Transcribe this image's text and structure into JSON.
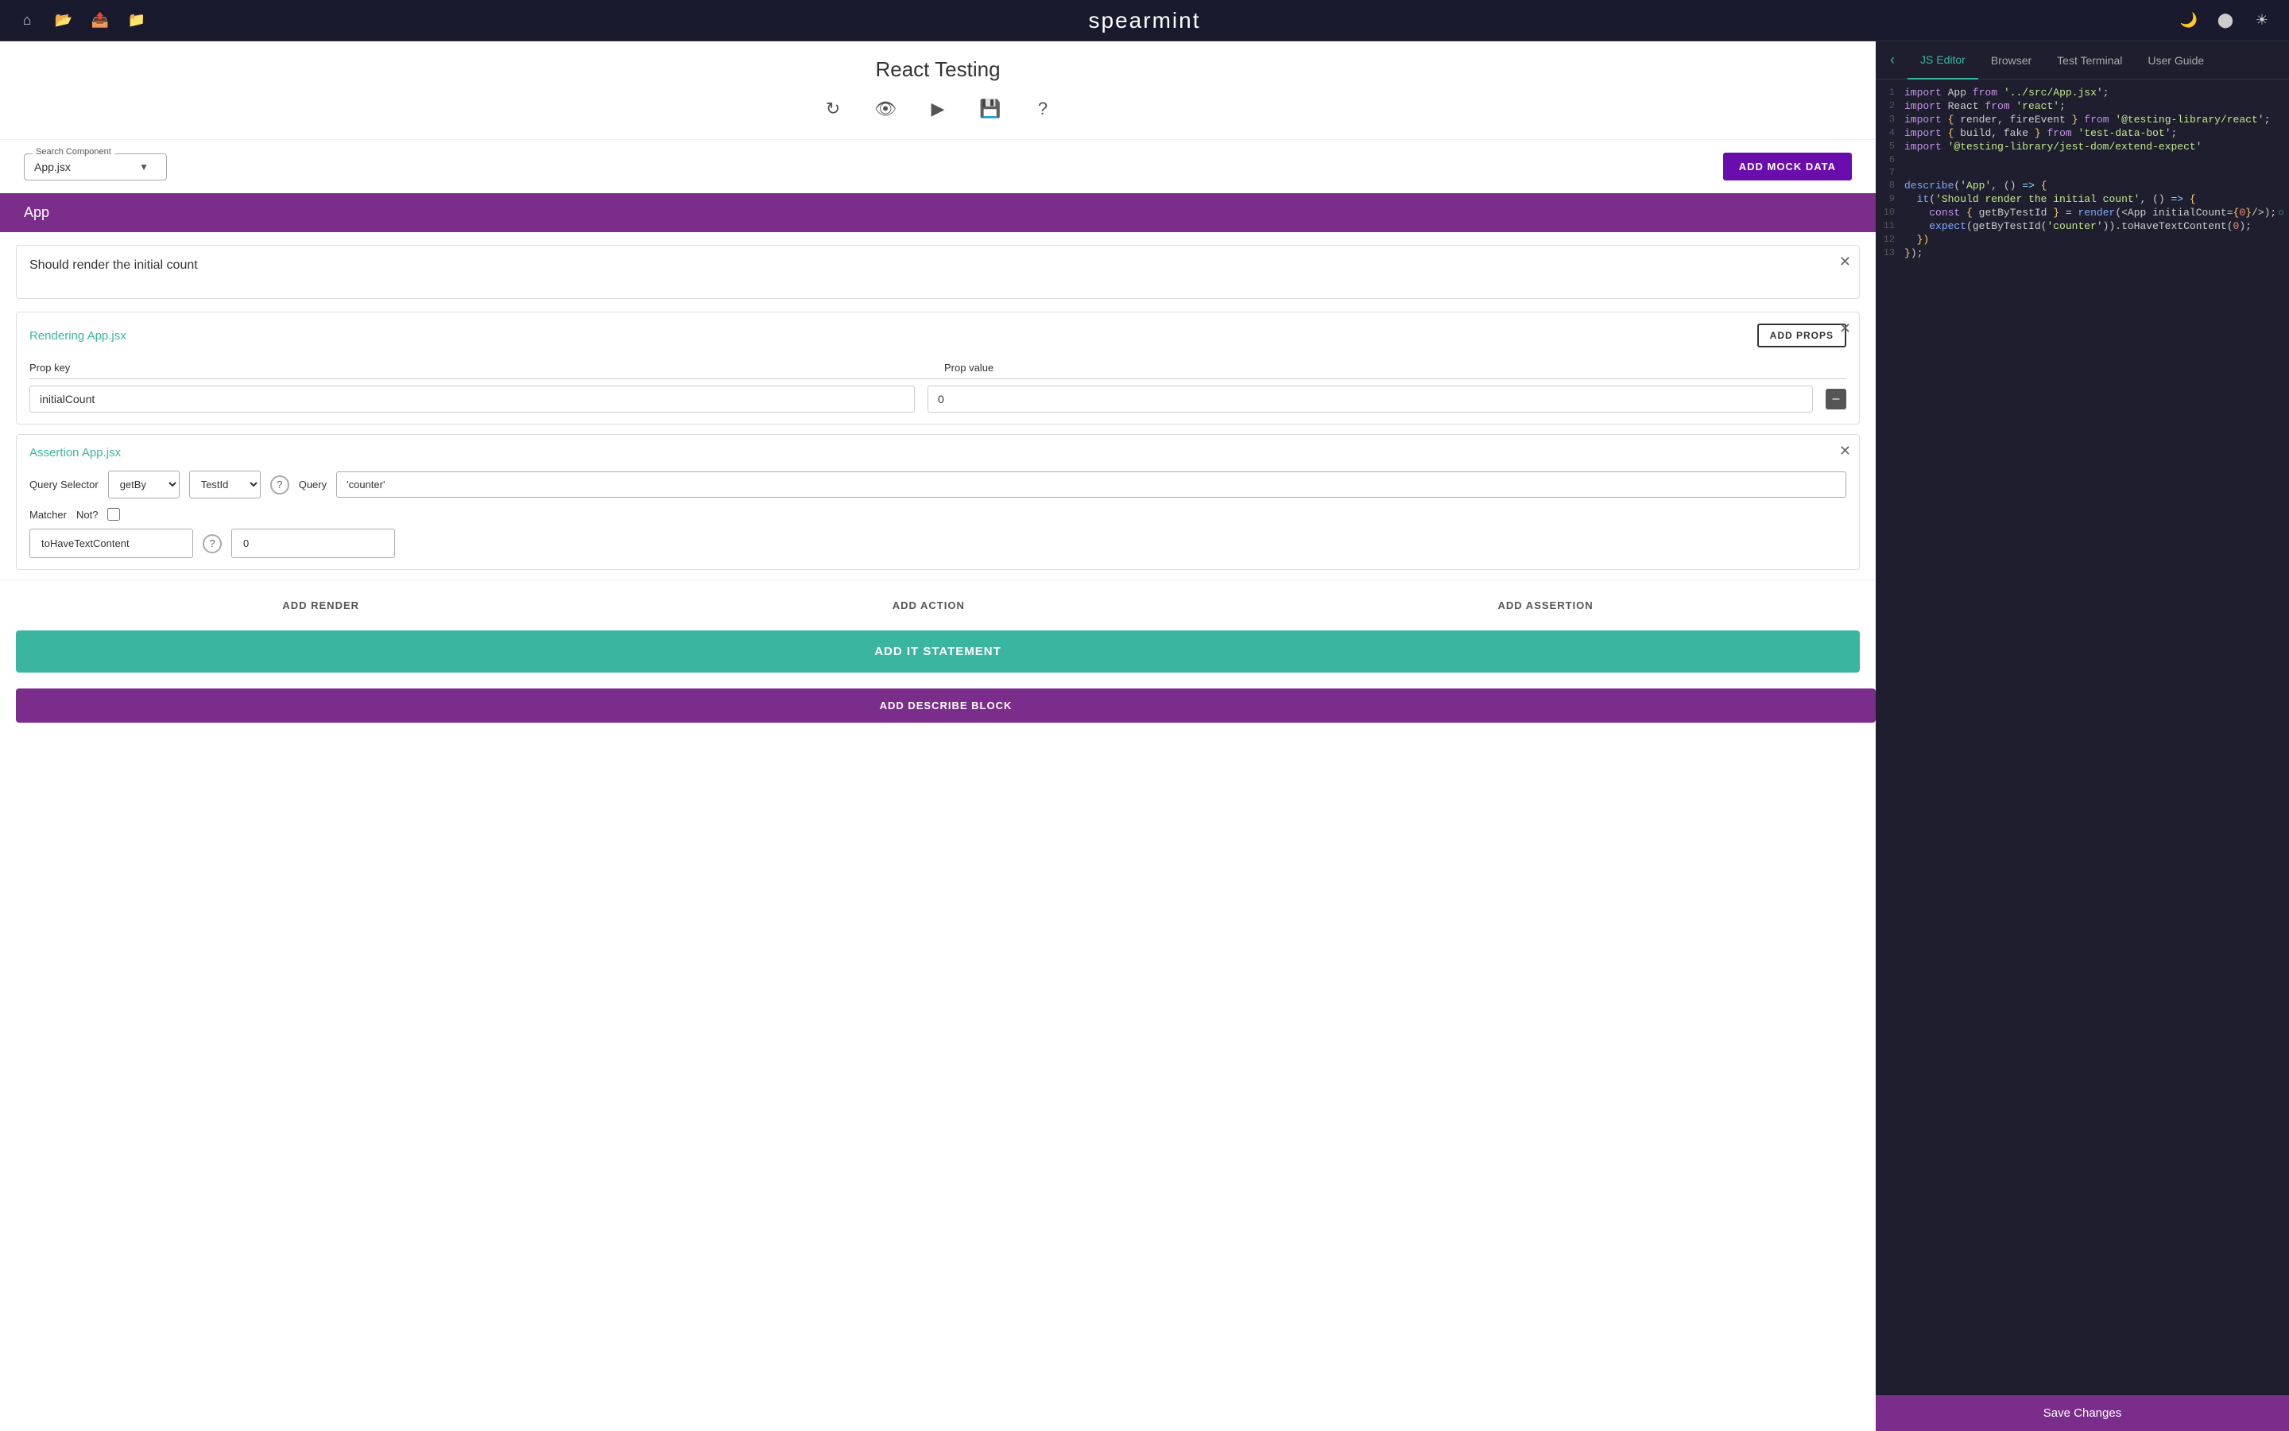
{
  "app": {
    "title": "spearmint"
  },
  "header": {
    "icons": [
      "home",
      "folder-open",
      "file-export",
      "folder",
      "moon",
      "circle",
      "sun"
    ]
  },
  "left_panel": {
    "title": "React Testing",
    "toolbar_icons": [
      "refresh",
      "eye",
      "play",
      "save",
      "help"
    ],
    "search": {
      "label": "Search Component",
      "value": "App.jsx",
      "add_mock_label": "ADD MOCK DATA"
    },
    "component_name": "App",
    "test_block": {
      "title": "Should render the initial count"
    },
    "render_block": {
      "label": "Rendering",
      "component": "App.jsx",
      "add_props_label": "ADD PROPS",
      "prop_key_header": "Prop key",
      "prop_value_header": "Prop value",
      "prop_key": "initialCount",
      "prop_value": "0"
    },
    "assertion_block": {
      "label": "Assertion",
      "component": "App.jsx",
      "query_selector_label": "Query Selector",
      "query_label": "Query",
      "query_selector_value": "getBy",
      "query_type_value": "TestId",
      "query_value": "'counter'",
      "matcher_label": "Matcher",
      "not_label": "Not?",
      "matcher_value": "toHaveTextContent",
      "matcher_arg": "0"
    },
    "actions": {
      "add_render": "ADD RENDER",
      "add_action": "ADD ACTION",
      "add_assertion": "ADD ASSERTION"
    },
    "add_it_label": "ADD IT STATEMENT",
    "add_describe_label": "ADD DESCRIBE BLOCK"
  },
  "right_panel": {
    "tabs": [
      {
        "label": "JS Editor",
        "active": true
      },
      {
        "label": "Browser",
        "active": false
      },
      {
        "label": "Test Terminal",
        "active": false
      },
      {
        "label": "User Guide",
        "active": false
      }
    ],
    "code_lines": [
      {
        "num": 1,
        "content": "import App from '../src/App.jsx';"
      },
      {
        "num": 2,
        "content": "import React from 'react';"
      },
      {
        "num": 3,
        "content": "import { render, fireEvent } from '@testing-library/react';"
      },
      {
        "num": 4,
        "content": "import { build, fake } from 'test-data-bot';"
      },
      {
        "num": 5,
        "content": "import '@testing-library/jest-dom/extend-expect'"
      },
      {
        "num": 6,
        "content": ""
      },
      {
        "num": 7,
        "content": ""
      },
      {
        "num": 8,
        "content": "describe('App', () => {"
      },
      {
        "num": 9,
        "content": "  it('Should render the initial count', () => {"
      },
      {
        "num": 10,
        "content": "    const { getByTestId } = render(<App initialCount={0}/>);"
      },
      {
        "num": 11,
        "content": "    expect(getByTestId('counter')).toHaveTextContent(0);"
      },
      {
        "num": 12,
        "content": "  })"
      },
      {
        "num": 13,
        "content": "});"
      }
    ],
    "save_label": "Save Changes"
  }
}
